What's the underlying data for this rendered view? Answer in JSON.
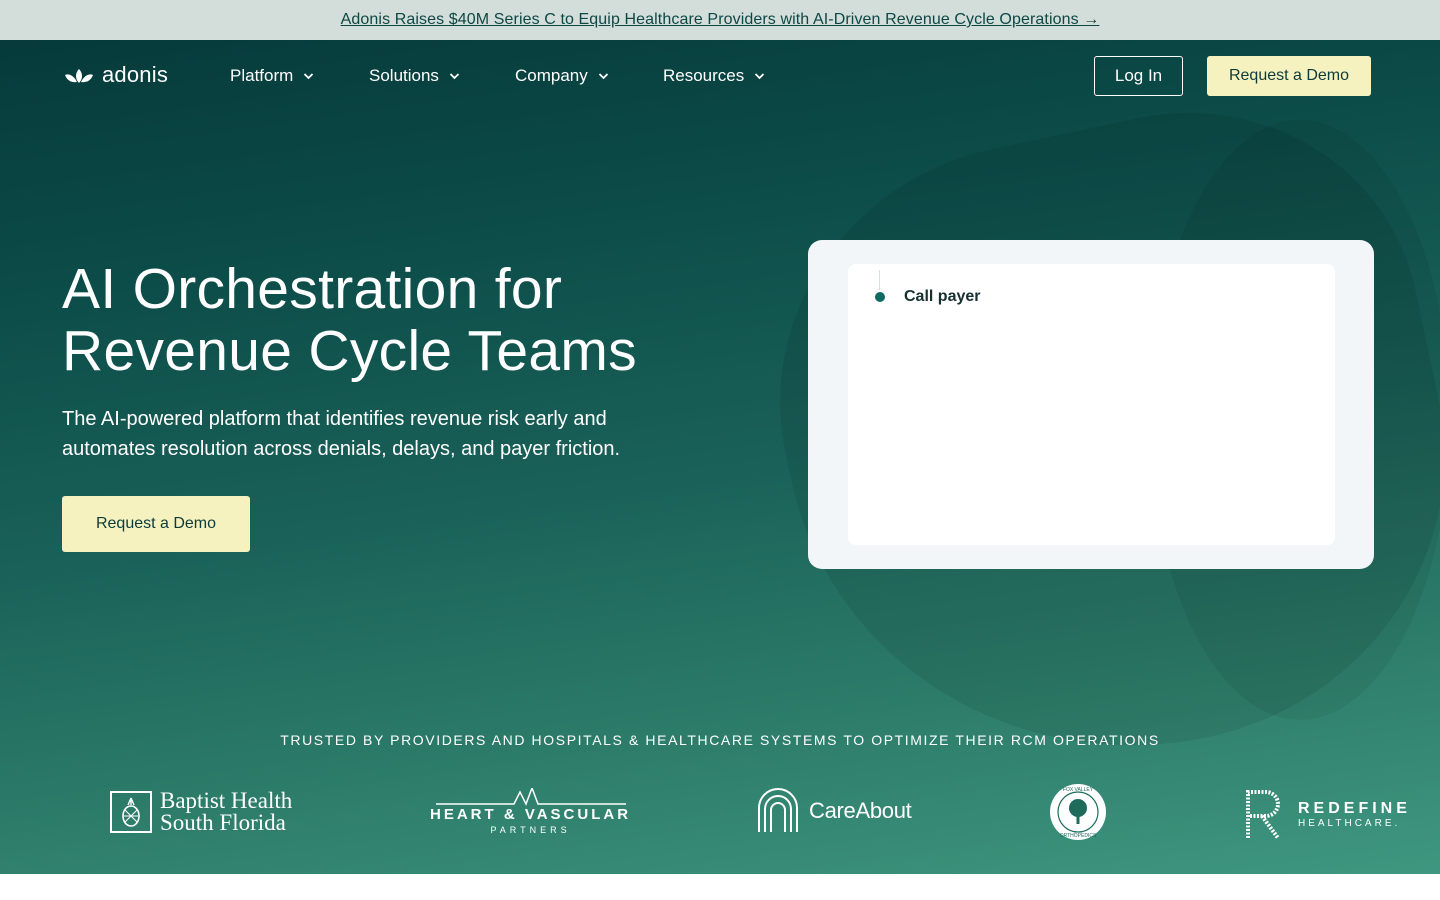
{
  "announcement": {
    "text": "Adonis Raises $40M Series C to Equip Healthcare Providers with AI-Driven Revenue Cycle Operations →"
  },
  "brand": {
    "name": "adonis",
    "accent": "#f6f2c0",
    "dark": "#063a3b"
  },
  "nav": {
    "items": [
      {
        "label": "Platform"
      },
      {
        "label": "Solutions"
      },
      {
        "label": "Company"
      },
      {
        "label": "Resources"
      }
    ],
    "login_label": "Log In",
    "demo_label": "Request a Demo"
  },
  "hero": {
    "title_line1": "AI Orchestration for",
    "title_line2": "Revenue Cycle Teams",
    "subtitle": "The AI-powered platform that identifies revenue risk early and automates resolution across denials, delays, and payer friction.",
    "cta_label": "Request a Demo"
  },
  "card": {
    "step_label": "Call payer"
  },
  "trusted": {
    "heading": "TRUSTED BY PROVIDERS AND HOSPITALS & HEALTHCARE SYSTEMS TO OPTIMIZE THEIR RCM OPERATIONS",
    "logos": [
      {
        "line1": "Baptist Health",
        "line2": "South Florida"
      },
      {
        "line1": "HEART & VASCULAR",
        "line2": "PARTNERS"
      },
      {
        "line1": "CareAbout"
      },
      {
        "line1": "FOX VALLEY",
        "line2": "ORTHOPEDICS"
      },
      {
        "line1": "REDEFINE",
        "line2": "HEALTHCARE."
      }
    ]
  }
}
